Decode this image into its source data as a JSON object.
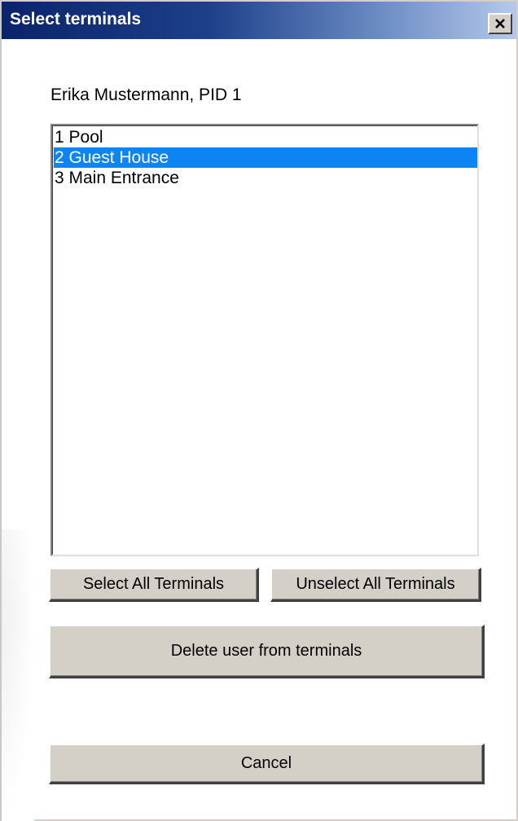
{
  "window": {
    "title": "Select terminals",
    "close_icon": "close-icon"
  },
  "person": {
    "label": "Erika Mustermann, PID 1"
  },
  "terminals": {
    "items": [
      {
        "label": "1 Pool",
        "selected": false
      },
      {
        "label": "2 Guest House",
        "selected": true
      },
      {
        "label": "3 Main Entrance",
        "selected": false
      }
    ]
  },
  "buttons": {
    "select_all": "Select All Terminals",
    "unselect_all": "Unselect All Terminals",
    "delete": "Delete user from terminals",
    "cancel": "Cancel"
  },
  "colors": {
    "title_bar_start": "#0a246a",
    "selection": "#0c84f4",
    "button_face": "#d4d0c8"
  }
}
